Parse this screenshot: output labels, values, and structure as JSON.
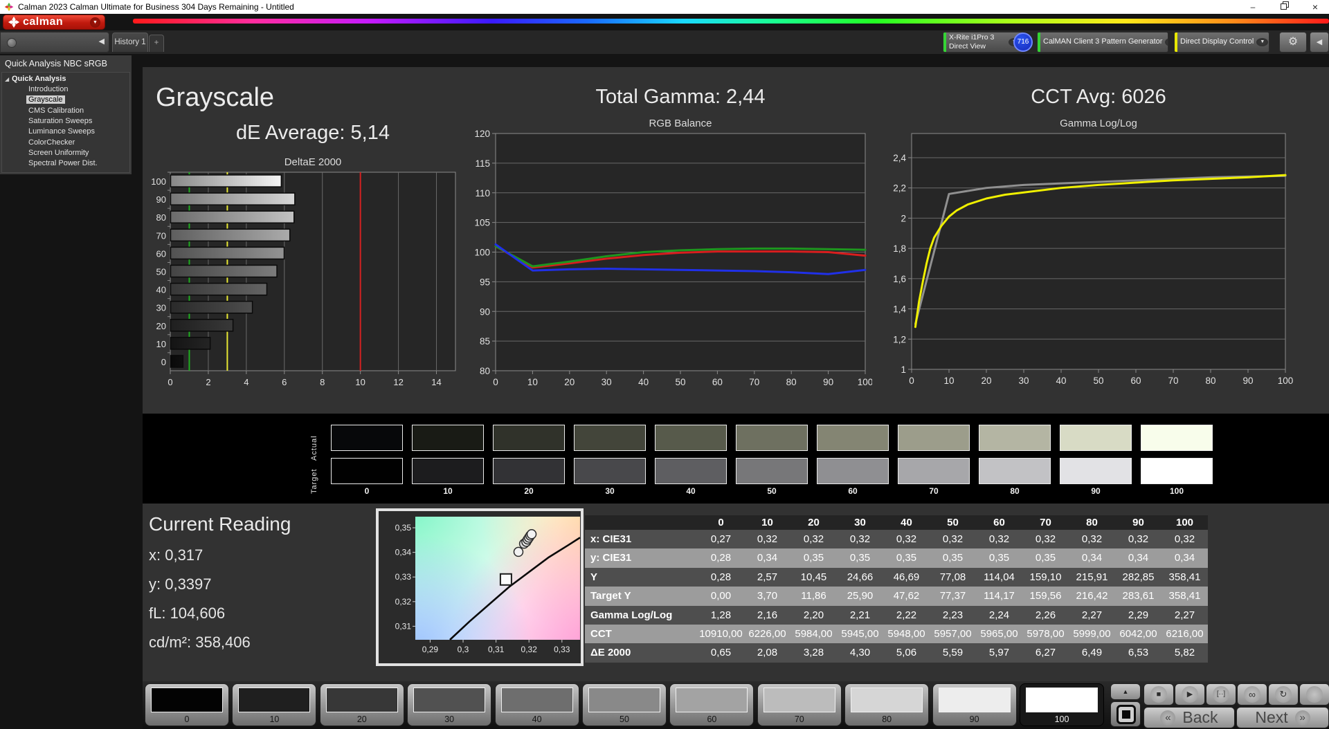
{
  "window": {
    "title": "Calman 2023 Calman Ultimate for Business 304 Days Remaining  - Untitled"
  },
  "brand": {
    "logo_text": "calman"
  },
  "icons": {
    "minimize": "–",
    "close": "×",
    "dropdown": "▼",
    "collapse_left": "◀",
    "gear": "⚙",
    "tree_expander": "◢",
    "up_arrow": "▲",
    "stop": "■",
    "play": "▶",
    "range": "[··]",
    "infinity": "∞",
    "loop": "↻",
    "back_chev": "«",
    "next_chev": "»"
  },
  "toolbar": {
    "tab": "History 1",
    "add_tab": "+",
    "meter": {
      "line1": "X-Rite i1Pro 3",
      "line2": "Direct View",
      "accent": "#35d435"
    },
    "badge": "716",
    "pattern_generator": {
      "label": "CalMAN Client 3 Pattern Generator",
      "accent": "#35d435"
    },
    "display_control": {
      "label": "Direct Display Control",
      "accent": "#e8e800"
    }
  },
  "sidebar": {
    "title": "Quick Analysis NBC sRGB",
    "root": "Quick Analysis",
    "items": [
      {
        "label": "Introduction",
        "selected": false
      },
      {
        "label": "Grayscale",
        "selected": true
      },
      {
        "label": "CMS Calibration",
        "selected": false
      },
      {
        "label": "Saturation Sweeps",
        "selected": false
      },
      {
        "label": "Luminance Sweeps",
        "selected": false
      },
      {
        "label": "ColorChecker",
        "selected": false
      },
      {
        "label": "Screen Uniformity",
        "selected": false
      },
      {
        "label": "Spectral Power Dist.",
        "selected": false
      }
    ]
  },
  "main": {
    "grayscale_title": "Grayscale",
    "de_average": "dE Average: 5,14",
    "total_gamma": "Total Gamma: 2,44",
    "cct_avg": "CCT Avg: 6026"
  },
  "current_reading": {
    "title": "Current Reading",
    "lines": [
      "x: 0,317",
      "y: 0,3397",
      "fL: 104,606",
      "cd/m²: 358,406"
    ]
  },
  "strip": {
    "row_labels": [
      "Actual",
      "Target"
    ],
    "levels": [
      "0",
      "10",
      "20",
      "30",
      "40",
      "50",
      "60",
      "70",
      "80",
      "90",
      "100"
    ],
    "actual_colors": [
      "#07080a",
      "#191b15",
      "#30322a",
      "#43453a",
      "#575a4b",
      "#6e7060",
      "#848573",
      "#9c9d8b",
      "#b4b5a3",
      "#d8dbc5",
      "#f8fdeb"
    ],
    "target_colors": [
      "#010101",
      "#1c1c1e",
      "#323235",
      "#48484b",
      "#5e5e61",
      "#777779",
      "#8f8f92",
      "#a7a7aa",
      "#c2c2c5",
      "#e2e2e5",
      "#ffffff"
    ]
  },
  "table": {
    "header": [
      "",
      "0",
      "10",
      "20",
      "30",
      "40",
      "50",
      "60",
      "70",
      "80",
      "90",
      "100"
    ],
    "rows": [
      {
        "label": "x: CIE31",
        "values": [
          "0,27",
          "0,32",
          "0,32",
          "0,32",
          "0,32",
          "0,32",
          "0,32",
          "0,32",
          "0,32",
          "0,32",
          "0,32"
        ]
      },
      {
        "label": "y: CIE31",
        "values": [
          "0,28",
          "0,34",
          "0,35",
          "0,35",
          "0,35",
          "0,35",
          "0,35",
          "0,35",
          "0,34",
          "0,34",
          "0,34"
        ]
      },
      {
        "label": "Y",
        "values": [
          "0,28",
          "2,57",
          "10,45",
          "24,66",
          "46,69",
          "77,08",
          "114,04",
          "159,10",
          "215,91",
          "282,85",
          "358,41"
        ]
      },
      {
        "label": "Target Y",
        "values": [
          "0,00",
          "3,70",
          "11,86",
          "25,90",
          "47,62",
          "77,37",
          "114,17",
          "159,56",
          "216,42",
          "283,61",
          "358,41"
        ]
      },
      {
        "label": "Gamma Log/Log",
        "values": [
          "1,28",
          "2,16",
          "2,20",
          "2,21",
          "2,22",
          "2,23",
          "2,24",
          "2,26",
          "2,27",
          "2,29",
          "2,27"
        ]
      },
      {
        "label": "CCT",
        "values": [
          "10910,00",
          "6226,00",
          "5984,00",
          "5945,00",
          "5948,00",
          "5957,00",
          "5965,00",
          "5978,00",
          "5999,00",
          "6042,00",
          "6216,00"
        ]
      },
      {
        "label": "ΔE 2000",
        "values": [
          "0,65",
          "2,08",
          "3,28",
          "4,30",
          "5,06",
          "5,59",
          "5,97",
          "6,27",
          "6,49",
          "6,53",
          "5,82"
        ]
      }
    ]
  },
  "bottom_bar": {
    "levels": [
      "0",
      "10",
      "20",
      "30",
      "40",
      "50",
      "60",
      "70",
      "80",
      "90",
      "100"
    ],
    "colors": [
      "#030303",
      "#1f1f1f",
      "#373737",
      "#515151",
      "#6e6e6e",
      "#898989",
      "#a3a3a3",
      "#bcbcbc",
      "#d6d6d6",
      "#ededed",
      "#ffffff"
    ],
    "selected_index": 10,
    "back_label": "Back",
    "next_label": "Next"
  },
  "chart_data": [
    {
      "id": "deltae2000",
      "type": "bar",
      "orientation": "horizontal",
      "title": "DeltaE 2000",
      "categories": [
        "100",
        "90",
        "80",
        "70",
        "60",
        "50",
        "40",
        "30",
        "20",
        "10",
        "0"
      ],
      "values": [
        5.82,
        6.53,
        6.49,
        6.27,
        5.97,
        5.59,
        5.06,
        4.3,
        3.28,
        2.08,
        0.65
      ],
      "bar_colors": [
        "#f5f5f5",
        "#d7d7d7",
        "#c2c2c2",
        "#ababab",
        "#939393",
        "#7c7c7c",
        "#646464",
        "#4d4d4d",
        "#383838",
        "#242424",
        "#101010"
      ],
      "xlim": [
        0,
        15
      ],
      "xticks": [
        0,
        2,
        4,
        6,
        8,
        10,
        12,
        14
      ],
      "reference_lines": [
        {
          "value": 1,
          "color": "#1fae1f"
        },
        {
          "value": 3,
          "color": "#e8e833"
        },
        {
          "value": 10,
          "color": "#d42020"
        }
      ]
    },
    {
      "id": "rgb_balance",
      "type": "line",
      "title": "RGB Balance",
      "x": [
        0,
        10,
        20,
        30,
        40,
        50,
        60,
        70,
        80,
        90,
        100
      ],
      "xticks": [
        0,
        10,
        20,
        30,
        40,
        50,
        60,
        70,
        80,
        90,
        100
      ],
      "ylim": [
        80,
        120
      ],
      "yticks": [
        80,
        85,
        90,
        95,
        100,
        105,
        110,
        115,
        120
      ],
      "series": [
        {
          "name": "Red",
          "color": "#d81e1e",
          "values": [
            101.0,
            97.4,
            98.1,
            98.9,
            99.5,
            99.9,
            100.1,
            100.1,
            100.1,
            100.0,
            99.4
          ]
        },
        {
          "name": "Green",
          "color": "#1e961e",
          "values": [
            101.0,
            97.6,
            98.4,
            99.3,
            100.0,
            100.3,
            100.5,
            100.6,
            100.6,
            100.5,
            100.4
          ]
        },
        {
          "name": "Blue",
          "color": "#2030e8",
          "values": [
            101.3,
            96.9,
            97.1,
            97.2,
            97.1,
            97.0,
            96.9,
            96.8,
            96.6,
            96.3,
            97.0
          ]
        }
      ]
    },
    {
      "id": "gamma_loglog",
      "type": "line",
      "title": "Gamma Log/Log",
      "xticks": [
        0,
        10,
        20,
        30,
        40,
        50,
        60,
        70,
        80,
        90,
        100
      ],
      "ylim": [
        1,
        2.56
      ],
      "yticks": [
        1,
        1.2,
        1.4,
        1.6,
        1.8,
        2,
        2.2,
        2.4
      ],
      "ytick_labels": [
        "1",
        "1,2",
        "1,4",
        "1,6",
        "1,8",
        "2",
        "2,2",
        "2,4"
      ],
      "series": [
        {
          "name": "Target gamma",
          "color": "#909090",
          "points": [
            [
              1,
              1.3
            ],
            [
              10,
              2.16
            ],
            [
              20,
              2.2
            ],
            [
              30,
              2.22
            ],
            [
              40,
              2.23
            ],
            [
              50,
              2.24
            ],
            [
              60,
              2.25
            ],
            [
              70,
              2.26
            ],
            [
              80,
              2.27
            ],
            [
              90,
              2.275
            ],
            [
              100,
              2.28
            ]
          ]
        },
        {
          "name": "Measured gamma",
          "color": "#f0f000",
          "points": [
            [
              1,
              1.28
            ],
            [
              2,
              1.45
            ],
            [
              3,
              1.58
            ],
            [
              4,
              1.7
            ],
            [
              5,
              1.8
            ],
            [
              6,
              1.87
            ],
            [
              8,
              1.95
            ],
            [
              10,
              2.01
            ],
            [
              12,
              2.05
            ],
            [
              15,
              2.09
            ],
            [
              20,
              2.13
            ],
            [
              25,
              2.155
            ],
            [
              30,
              2.17
            ],
            [
              40,
              2.2
            ],
            [
              50,
              2.22
            ],
            [
              60,
              2.235
            ],
            [
              70,
              2.25
            ],
            [
              80,
              2.26
            ],
            [
              90,
              2.27
            ],
            [
              100,
              2.285
            ]
          ]
        }
      ]
    },
    {
      "id": "cie_detail",
      "type": "scatter",
      "xlim": [
        0.2855,
        0.3355
      ],
      "ylim": [
        0.3045,
        0.3545
      ],
      "xtick_values": [
        0.29,
        0.3,
        0.31,
        0.32,
        0.33
      ],
      "xtick_labels": [
        "0,29",
        "0,3",
        "0,31",
        "0,32",
        "0,33"
      ],
      "ytick_values": [
        0.35,
        0.34,
        0.33,
        0.32,
        0.31
      ],
      "ytick_labels": [
        "0,35",
        "0,34",
        "0,33",
        "0,32",
        "0,31"
      ],
      "locus": [
        [
          0.296,
          0.3045
        ],
        [
          0.302,
          0.312
        ],
        [
          0.308,
          0.319
        ],
        [
          0.314,
          0.326
        ],
        [
          0.32,
          0.332
        ],
        [
          0.326,
          0.338
        ],
        [
          0.332,
          0.343
        ],
        [
          0.3355,
          0.346
        ]
      ],
      "target_square": [
        0.313,
        0.329
      ],
      "points": [
        [
          0.3168,
          0.3402
        ],
        [
          0.3185,
          0.3435
        ],
        [
          0.3192,
          0.3443
        ],
        [
          0.3196,
          0.3452
        ],
        [
          0.32,
          0.346
        ],
        [
          0.3204,
          0.3468
        ],
        [
          0.3208,
          0.3474
        ]
      ]
    }
  ]
}
